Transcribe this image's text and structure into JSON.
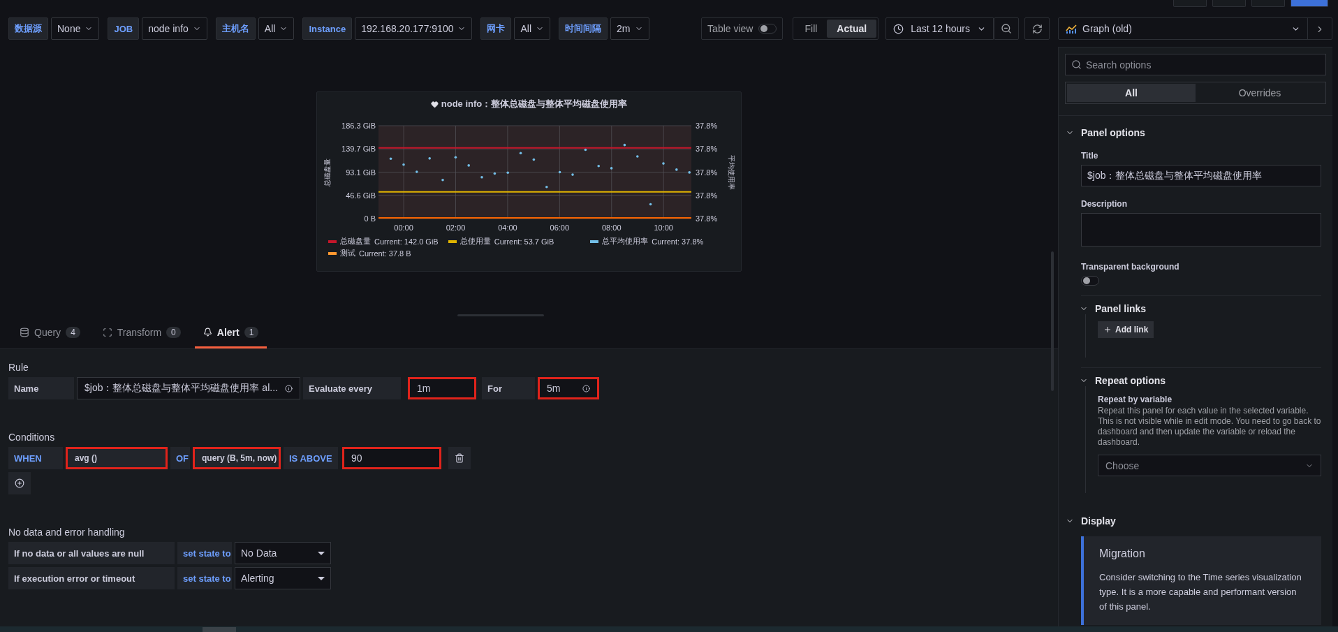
{
  "top_buttons": [
    {
      "primary": false
    },
    {
      "primary": false
    },
    {
      "primary": false
    },
    {
      "primary": true
    }
  ],
  "variables": [
    {
      "label": "数据源",
      "value": "None"
    },
    {
      "label": "JOB",
      "value": "node info"
    },
    {
      "label": "主机名",
      "value": "All"
    },
    {
      "label": "Instance",
      "value": "192.168.20.177:9100"
    },
    {
      "label": "网卡",
      "value": "All"
    },
    {
      "label": "时间间隔",
      "value": "2m"
    }
  ],
  "table_view": {
    "label": "Table view",
    "on": false
  },
  "fill_modes": [
    {
      "label": "Fill",
      "selected": false
    },
    {
      "label": "Actual",
      "selected": true
    }
  ],
  "time_range": "Last 12 hours",
  "visualization": "Graph (old)",
  "panel": {
    "title": "node info：整体总磁盘与整体平均磁盘使用率",
    "left_axis_title": "总磁盘量",
    "right_axis_title": "平均使用率",
    "right_axis_labels": [
      "37.8%",
      "37.8%",
      "37.8%",
      "37.8%",
      "37.8%"
    ],
    "chart_data": {
      "type": "line",
      "grid": true,
      "xlim": [
        -0.97,
        11.07
      ],
      "ylim": [
        0,
        186.3
      ],
      "xticks": [
        {
          "value": 0,
          "label": "00:00"
        },
        {
          "value": 2,
          "label": "02:00"
        },
        {
          "value": 4,
          "label": "04:00"
        },
        {
          "value": 6,
          "label": "06:00"
        },
        {
          "value": 8,
          "label": "08:00"
        },
        {
          "value": 10,
          "label": "10:00"
        }
      ],
      "yticks": [
        {
          "value": 0,
          "label": "0 B"
        },
        {
          "value": 46.6,
          "label": "46.6 GiB"
        },
        {
          "value": 93.1,
          "label": "93.1 GiB"
        },
        {
          "value": 139.7,
          "label": "139.7 GiB"
        },
        {
          "value": 186.3,
          "label": "186.3 GiB"
        }
      ],
      "x": [
        -0.97,
        11.07
      ],
      "series": [
        {
          "color": "#c4162a",
          "values": [
            142.0,
            142.0
          ]
        },
        {
          "color": "#e0b400",
          "values": [
            53.7,
            53.7
          ]
        },
        {
          "color": "#fa6400",
          "values": [
            0,
            0
          ]
        }
      ]
    },
    "legend": [
      {
        "name": "总磁盘量",
        "current": "Current: 142.0 GiB",
        "color": "#c4162a"
      },
      {
        "name": "总使用量",
        "current": "Current: 53.7 GiB",
        "color": "#e0b400"
      },
      {
        "name": "总平均使用率",
        "current": "Current: 37.8%",
        "color": "#73bfe8"
      },
      {
        "name": "测试",
        "current": "Current: 37.8 B",
        "color": "#ff9830"
      }
    ]
  },
  "editor_tabs": [
    {
      "label": "Query",
      "count": "4",
      "selected": false
    },
    {
      "label": "Transform",
      "count": "0",
      "selected": false
    },
    {
      "label": "Alert",
      "count": "1",
      "selected": true
    }
  ],
  "rule": {
    "heading": "Rule",
    "name_label": "Name",
    "name_value": "$job：整体总磁盘与整体平均磁盘使用率 al...",
    "evaluate_label": "Evaluate every",
    "evaluate_value": "1m",
    "evaluate_highlighted": true,
    "for_label": "For",
    "for_value": "5m",
    "for_highlighted": true
  },
  "conditions": {
    "heading": "Conditions",
    "when": "WHEN",
    "reducer": "avg ()",
    "reducer_highlighted": true,
    "of": "OF",
    "query": "query (B, 5m, now)",
    "query_highlighted": true,
    "evaluator": "IS ABOVE",
    "threshold": "90",
    "threshold_highlighted": true
  },
  "no_data": {
    "heading": "No data and error handling",
    "rows": [
      {
        "label": "If no data or all values are null",
        "action": "set state to",
        "value": "No Data"
      },
      {
        "label": "If execution error or timeout",
        "action": "set state to",
        "value": "Alerting"
      }
    ]
  },
  "options": {
    "search_placeholder": "Search options",
    "tabs": [
      {
        "label": "All",
        "selected": true
      },
      {
        "label": "Overrides",
        "selected": false
      }
    ],
    "panel_options": {
      "heading": "Panel options",
      "expanded": true,
      "title_label": "Title",
      "title_value": "$job：整体总磁盘与整体平均磁盘使用率",
      "description_label": "Description",
      "transparent_label": "Transparent background",
      "transparent_on": false
    },
    "panel_links": {
      "heading": "Panel links",
      "expanded": true,
      "add_button": "Add link"
    },
    "repeat": {
      "heading": "Repeat options",
      "expanded": true,
      "label": "Repeat by variable",
      "description": "Repeat this panel for each value in the selected variable. This is not visible while in edit mode. You need to go back to dashboard and then update the variable or reload the dashboard.",
      "placeholder": "Choose"
    },
    "display": {
      "heading": "Display",
      "expanded": true,
      "migration_title": "Migration",
      "migration_text": "Consider switching to the Time series visualization type. It is a more capable and performant version of this panel."
    }
  }
}
